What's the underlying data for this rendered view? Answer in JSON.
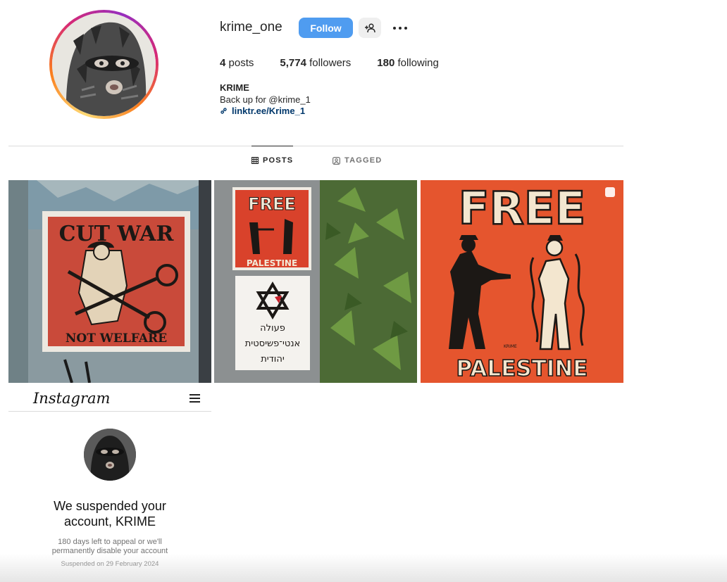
{
  "profile": {
    "username": "krime_one",
    "follow_label": "Follow",
    "stats": {
      "posts_count": "4",
      "posts_label": "posts",
      "followers_count": "5,774",
      "followers_label": "followers",
      "following_count": "180",
      "following_label": "following"
    },
    "full_name": "KRIME",
    "bio": "Back up for @krime_1",
    "link": "linktr.ee/Krime_1"
  },
  "tabs": [
    {
      "label": "POSTS",
      "active": true
    },
    {
      "label": "TAGGED",
      "active": false
    }
  ],
  "posts": {
    "post1": {
      "top_text": "CUT WAR",
      "bottom_text": "NOT WELFARE"
    },
    "post2": {
      "top_text": "FREE",
      "bottom_text": "PALESTINE",
      "hebrew_line1": "פעולה",
      "hebrew_line2": "אנטי־פשיסטית",
      "hebrew_line3": "יהודית"
    },
    "post3": {
      "top_text": "FREE",
      "bottom_text": "PALESTINE",
      "signature": "KRIME"
    },
    "post4": {
      "app_name": "Instagram",
      "title_line1": "We suspended your",
      "title_line2": "account, KRIME",
      "subtitle_line1": "180 days left to appeal or we'll",
      "subtitle_line2": "permanently disable your account",
      "date": "Suspended on 29 February 2024"
    }
  },
  "icons": [
    "link-icon",
    "add-person-icon",
    "more-icon",
    "grid-icon",
    "tagged-icon",
    "menu-icon"
  ],
  "colors": {
    "follow_button": "#4f9cf0",
    "link": "#00376b",
    "poster_red": "#d9422b",
    "poster_orange": "#e5552e"
  }
}
